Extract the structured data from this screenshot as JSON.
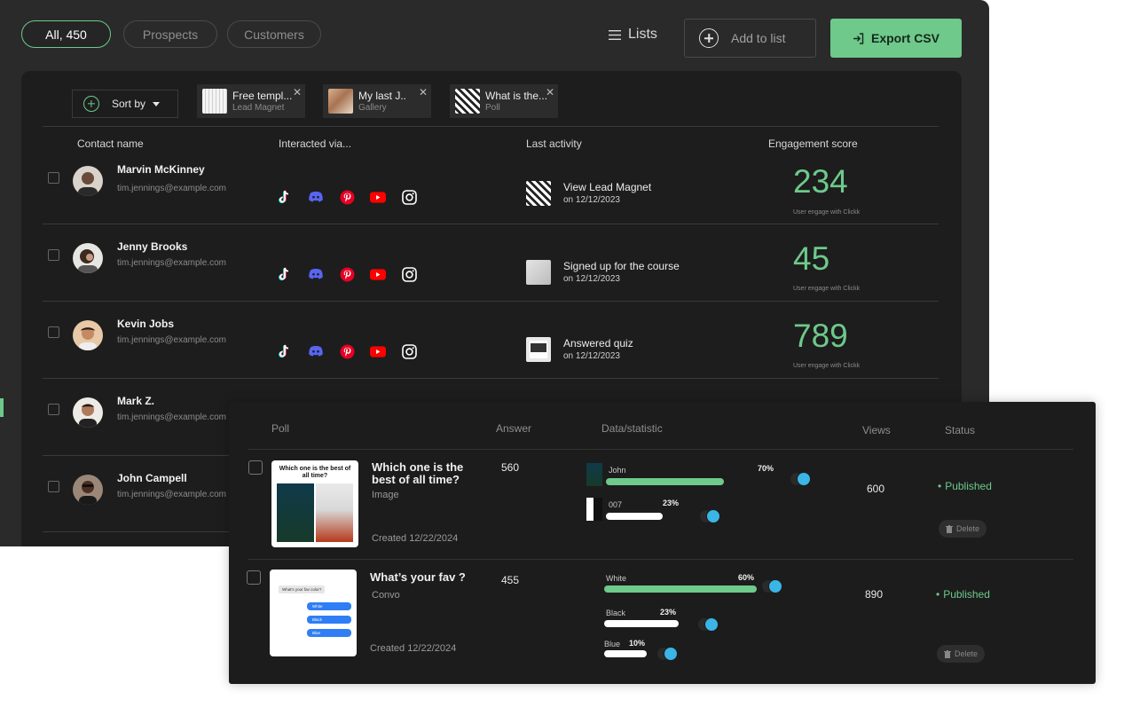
{
  "filters": [
    {
      "label": "All, 450",
      "active": true
    },
    {
      "label": "Prospects",
      "active": false
    },
    {
      "label": "Customers",
      "active": false
    }
  ],
  "toolbar": {
    "lists_label": "Lists",
    "add_to_list_label": "Add to list",
    "export_label": "Export CSV"
  },
  "sort": {
    "label": "Sort by"
  },
  "chips": [
    {
      "title": "Free templ...",
      "subtitle": "Lead Magnet"
    },
    {
      "title": "My last J..",
      "subtitle": "Gallery"
    },
    {
      "title": "What is the...",
      "subtitle": "Poll"
    }
  ],
  "columns": {
    "contact": "Contact name",
    "interacted": "Interacted via...",
    "activity": "Last activity",
    "score": "Engagement score"
  },
  "contacts": [
    {
      "name": "Marvin McKinney",
      "email": "tim.jennings@example.com",
      "activity": "View Lead Magnet",
      "date": "on 12/12/2023",
      "score": "234",
      "score_note": "User engage with Clickk"
    },
    {
      "name": "Jenny Brooks",
      "email": "tim.jennings@example.com",
      "activity": "Signed up for the course",
      "date": "on 12/12/2023",
      "score": "45",
      "score_note": "User engage with Clickk"
    },
    {
      "name": "Kevin Jobs",
      "email": "tim.jennings@example.com",
      "activity": "Answered quiz",
      "date": "on 12/12/2023",
      "score": "789",
      "score_note": "User engage with Clickk"
    },
    {
      "name": "Mark Z.",
      "email": "tim.jennings@example.com"
    },
    {
      "name": "John Campell",
      "email": "tim.jennings@example.com"
    }
  ],
  "social_icons": [
    "tiktok-icon",
    "discord-icon",
    "pinterest-icon",
    "youtube-icon",
    "instagram-icon"
  ],
  "colors": {
    "accent": "#6ec98b",
    "discord": "#5865f2",
    "pinterest": "#e60023",
    "youtube": "#ff0000"
  },
  "polls": {
    "headers": {
      "poll": "Poll",
      "answer": "Answer",
      "stats": "Data/statistic",
      "views": "Views",
      "status": "Status"
    },
    "rows": [
      {
        "title_line1": "Which one is the",
        "title_line2": "best of all time?",
        "type": "Image",
        "created": "Created 12/22/2024",
        "answers": "560",
        "views": "600",
        "status": "Published",
        "delete_label": "Delete",
        "thumb_text": "Which one is the best of all time?",
        "options": [
          {
            "label": "John",
            "percent": "70%",
            "fraction": 0.7
          },
          {
            "label": "007",
            "percent": "23%",
            "fraction": 0.23
          }
        ]
      },
      {
        "title_line1": "What’s your fav ?",
        "type": "Convo",
        "created": "Created 12/22/2024",
        "answers": "455",
        "views": "890",
        "status": "Published",
        "delete_label": "Delete",
        "thumb_text": "What's your fav color?",
        "bubbles": [
          "White",
          "Black",
          "Blue"
        ],
        "options": [
          {
            "label": "White",
            "percent": "60%",
            "fraction": 0.6
          },
          {
            "label": "Black",
            "percent": "23%",
            "fraction": 0.23
          },
          {
            "label": "Blue",
            "percent": "10%",
            "fraction": 0.1
          }
        ]
      }
    ]
  }
}
